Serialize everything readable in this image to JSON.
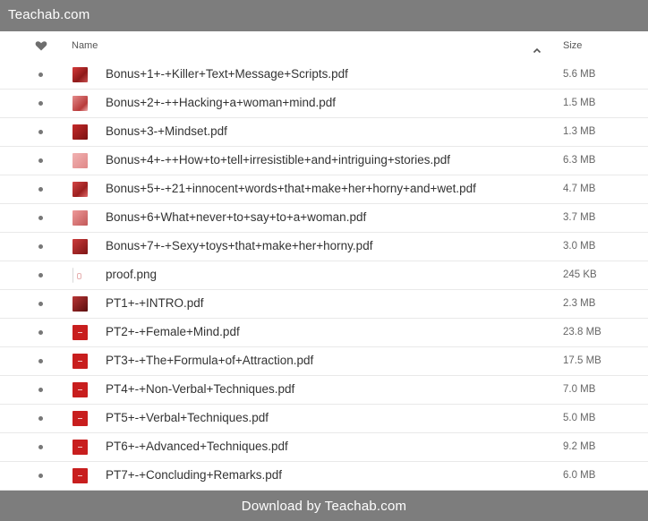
{
  "topbar": {
    "title": "Teachab.com"
  },
  "header": {
    "favorite_icon": "heart-icon",
    "name_label": "Name",
    "sort_icon": "chevron-up-icon",
    "size_label": "Size"
  },
  "files": [
    {
      "name": "Bonus+1+-+Killer+Text+Message+Scripts.pdf",
      "size": "5.6 MB",
      "thumb": "pdf1"
    },
    {
      "name": "Bonus+2+-++Hacking+a+woman+mind.pdf",
      "size": "1.5 MB",
      "thumb": "pdf2"
    },
    {
      "name": "Bonus+3-+Mindset.pdf",
      "size": "1.3 MB",
      "thumb": "pdf3"
    },
    {
      "name": "Bonus+4+-++How+to+tell+irresistible+and+intriguing+stories.pdf",
      "size": "6.3 MB",
      "thumb": "pdf4"
    },
    {
      "name": "Bonus+5+-+21+innocent+words+that+make+her+horny+and+wet.pdf",
      "size": "4.7 MB",
      "thumb": "pdf5"
    },
    {
      "name": "Bonus+6+What+never+to+say+to+a+woman.pdf",
      "size": "3.7 MB",
      "thumb": "pdf6"
    },
    {
      "name": "Bonus+7+-+Sexy+toys+that+make+her+horny.pdf",
      "size": "3.0 MB",
      "thumb": "pdf7"
    },
    {
      "name": "proof.png",
      "size": "245 KB",
      "thumb": "png"
    },
    {
      "name": "PT1+-+INTRO.pdf",
      "size": "2.3 MB",
      "thumb": "pt1"
    },
    {
      "name": "PT2+-+Female+Mind.pdf",
      "size": "23.8 MB",
      "thumb": "pt"
    },
    {
      "name": "PT3+-+The+Formula+of+Attraction.pdf",
      "size": "17.5 MB",
      "thumb": "pt"
    },
    {
      "name": "PT4+-+Non-Verbal+Techniques.pdf",
      "size": "7.0 MB",
      "thumb": "pt"
    },
    {
      "name": "PT5+-+Verbal+Techniques.pdf",
      "size": "5.0 MB",
      "thumb": "pt"
    },
    {
      "name": "PT6+-+Advanced+Techniques.pdf",
      "size": "9.2 MB",
      "thumb": "pt"
    },
    {
      "name": "PT7+-+Concluding+Remarks.pdf",
      "size": "6.0 MB",
      "thumb": "pt"
    }
  ],
  "footer": {
    "label": "Download by Teachab.com"
  },
  "colors": {
    "bar_bg": "#7d7d7d",
    "bar_text": "#ffffff",
    "row_divider": "#e9e9e9",
    "thumb_red": "#c81e1e"
  }
}
